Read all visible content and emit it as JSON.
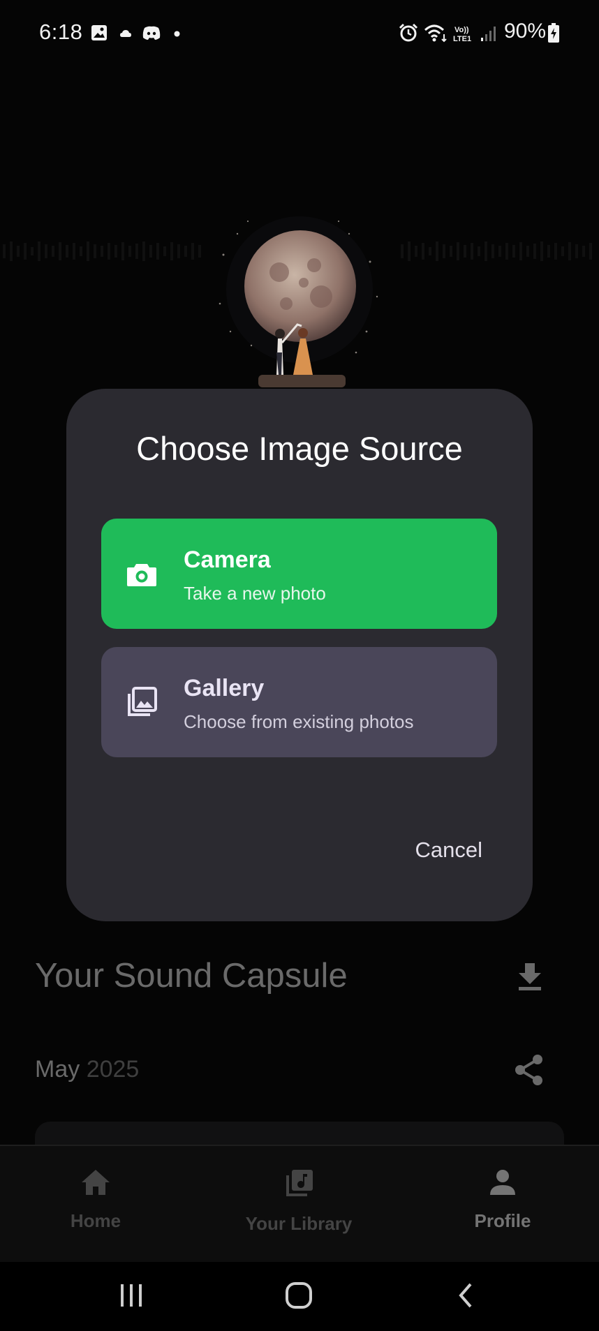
{
  "status_bar": {
    "time": "6:18",
    "battery": "90%",
    "icons": [
      "gallery-notification-icon",
      "cloud-icon",
      "discord-icon",
      "dot-icon",
      "alarm-icon",
      "wifi-icon",
      "volte-icon",
      "signal-icon",
      "battery-charging-icon"
    ],
    "volte_text": "Vo))\nLTE1"
  },
  "dialog": {
    "title": "Choose Image Source",
    "options": [
      {
        "title": "Camera",
        "subtitle": "Take a new photo",
        "icon": "camera-icon",
        "color": "#1fbb59"
      },
      {
        "title": "Gallery",
        "subtitle": "Choose from existing photos",
        "icon": "photo-library-icon",
        "color": "#4a4659"
      }
    ],
    "cancel_label": "Cancel"
  },
  "background": {
    "capsule_title": "Your Sound Capsule",
    "month": "May",
    "year": "2025",
    "icons": [
      "download-icon",
      "share-icon"
    ]
  },
  "bottom_nav": {
    "items": [
      {
        "label": "Home",
        "icon": "home-icon"
      },
      {
        "label": "Your Library",
        "icon": "library-icon"
      },
      {
        "label": "Profile",
        "icon": "profile-icon",
        "active": true
      }
    ]
  },
  "colors": {
    "accent": "#1fbb59",
    "dialog_bg": "#2b2a30",
    "gallery_bg": "#4a4659"
  }
}
